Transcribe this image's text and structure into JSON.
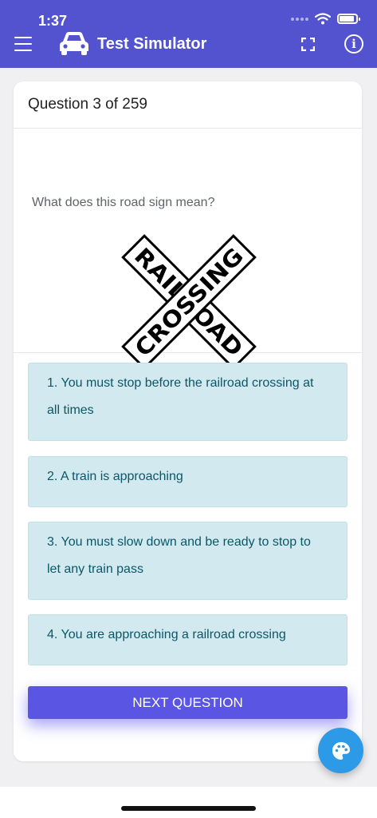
{
  "status_bar": {
    "time": "1:37"
  },
  "app_bar": {
    "title": "Test Simulator"
  },
  "question": {
    "header": "Question 3 of 259",
    "prompt": "What does this road sign mean?",
    "sign": {
      "word1": "RAILROAD",
      "word2": "CROSSING"
    }
  },
  "answers": [
    {
      "label": "1. You must stop before the railroad crossing at all times"
    },
    {
      "label": "2. A train is approaching"
    },
    {
      "label": "3. You must slow down and be ready to stop to let any train pass"
    },
    {
      "label": "4. You are approaching a railroad crossing"
    }
  ],
  "next_button": {
    "label": "NEXT QUESTION"
  },
  "colors": {
    "app_bar": "#5353d0",
    "answer_bg": "#d2eaef",
    "answer_text": "#0b5668",
    "button": "#5a55e3",
    "fab": "#2d9ae8"
  }
}
